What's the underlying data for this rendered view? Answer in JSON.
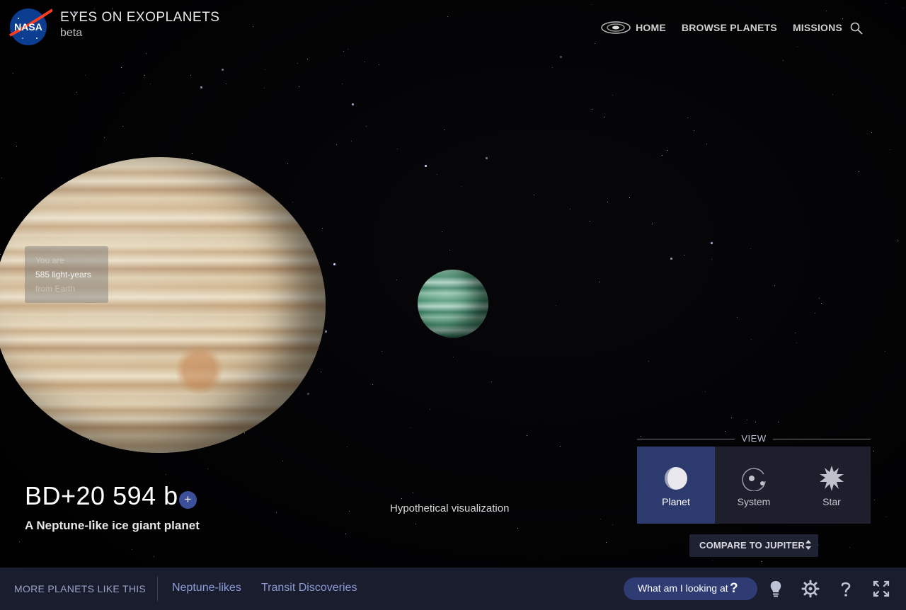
{
  "header": {
    "logo_text": "NASA",
    "app_title": "EYES ON EXOPLANETS",
    "app_subtitle": "beta",
    "nav": [
      {
        "label": "HOME",
        "icon": "galaxy-icon"
      },
      {
        "label": "BROWSE PLANETS"
      },
      {
        "label": "MISSIONS"
      }
    ],
    "search_icon": "search-icon"
  },
  "distance": {
    "line1": "You are",
    "line2": "585 light-years",
    "line3": "from Earth"
  },
  "planet": {
    "name": "BD+20 594 b",
    "add_label": "+",
    "description": "A Neptune-like ice giant planet"
  },
  "visualization_label": "Hypothetical visualization",
  "view_panel": {
    "title": "VIEW",
    "tabs": [
      {
        "label": "Planet",
        "icon": "planet-icon",
        "active": true
      },
      {
        "label": "System",
        "icon": "system-icon",
        "active": false
      },
      {
        "label": "Star",
        "icon": "star-icon",
        "active": false
      }
    ],
    "compare_label": "COMPARE TO JUPITER"
  },
  "bottom_bar": {
    "more_label": "MORE PLANETS LIKE THIS",
    "categories": [
      "Neptune-likes",
      "Transit Discoveries"
    ],
    "what_label": "What am I looking at",
    "what_icon": "question-icon",
    "icons": [
      "lightbulb-icon",
      "settings-icon",
      "help-icon",
      "fullscreen-icon"
    ]
  },
  "colors": {
    "bar_background": "#1a1d2e",
    "accent": "#2f3b73",
    "active_tab": "#2c3a6d",
    "link": "#8d9bd6"
  }
}
